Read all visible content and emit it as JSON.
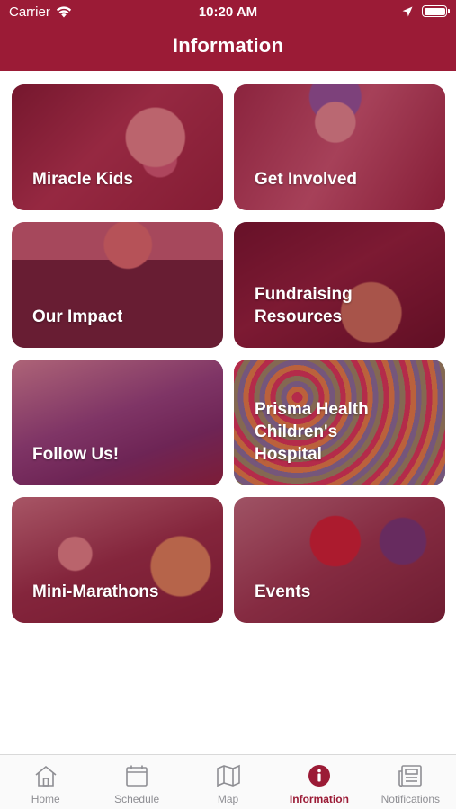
{
  "status_bar": {
    "carrier": "Carrier",
    "time": "10:20 AM"
  },
  "header": {
    "title": "Information"
  },
  "tiles": [
    {
      "label": "Miracle Kids"
    },
    {
      "label": "Get Involved"
    },
    {
      "label": "Our Impact"
    },
    {
      "label": "Fundraising Resources"
    },
    {
      "label": "Follow Us!"
    },
    {
      "label": "Prisma Health Children's Hospital"
    },
    {
      "label": "Mini-Marathons"
    },
    {
      "label": "Events"
    }
  ],
  "tabbar": {
    "items": [
      {
        "label": "Home",
        "icon": "home-icon"
      },
      {
        "label": "Schedule",
        "icon": "calendar-icon"
      },
      {
        "label": "Map",
        "icon": "map-icon"
      },
      {
        "label": "Information",
        "icon": "info-icon",
        "active": true
      },
      {
        "label": "Notifications",
        "icon": "newspaper-icon"
      }
    ]
  },
  "colors": {
    "brand": "#9b1b36",
    "inactive_tab": "#8e8e93"
  }
}
